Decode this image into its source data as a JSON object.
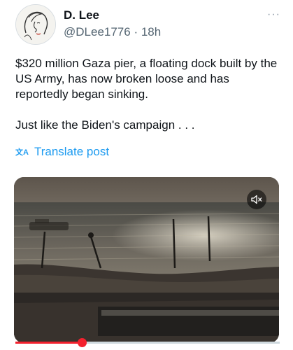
{
  "post": {
    "author_name": "D. Lee",
    "author_handle": "@DLee1776",
    "separator": " · ",
    "time_ago": "18h",
    "more_label": "···",
    "text_lines": [
      "$320 million Gaza pier, a floating dock built by the US Army, has now broken loose and has reportedly began sinking.",
      "Just like the Biden's campaign . . ."
    ],
    "translate_label": "Translate post",
    "translate_icon": "translate-icon"
  },
  "media": {
    "type": "video",
    "mute_icon": "speaker-muted-icon",
    "progress": 0.25
  },
  "colors": {
    "link": "#1d9bf0",
    "progress": "#f4212e",
    "muted_text": "#536471"
  }
}
